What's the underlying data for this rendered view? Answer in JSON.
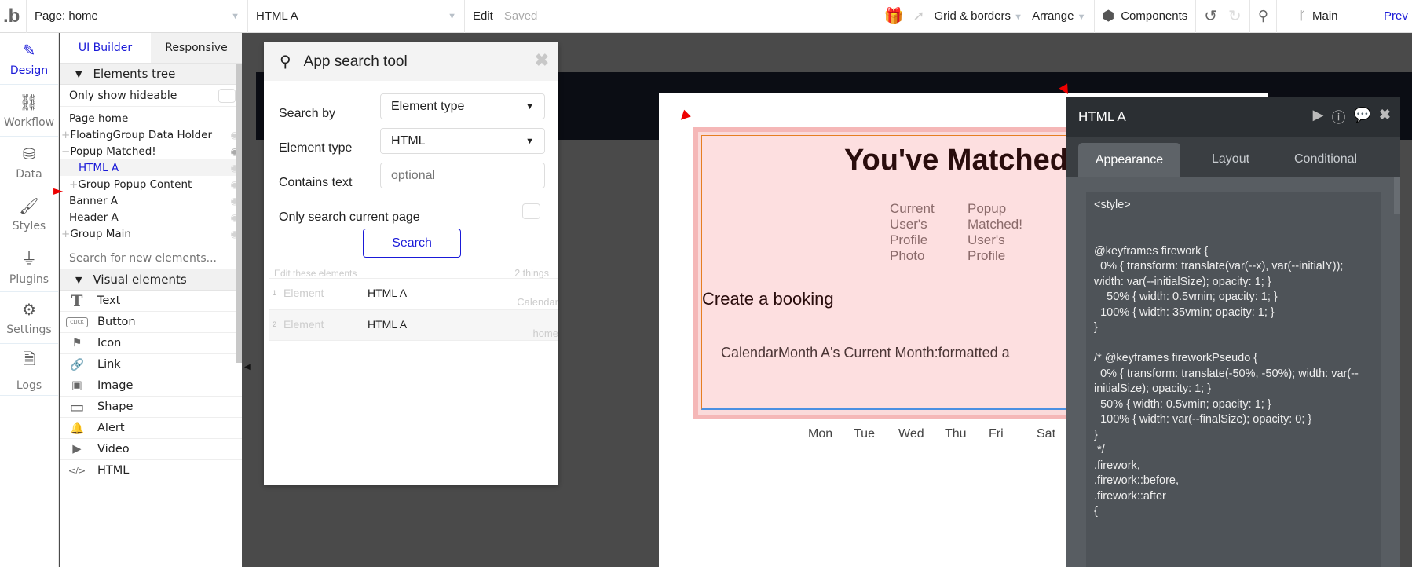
{
  "topbar": {
    "logo": ".b",
    "page_select": "Page: home",
    "element_select": "HTML A",
    "edit": "Edit",
    "saved": "Saved",
    "grid": "Grid & borders",
    "arrange": "Arrange",
    "components": "Components",
    "branch": "Main",
    "preview": "Prev"
  },
  "rail": [
    {
      "label": "Design",
      "icon": "design-icon"
    },
    {
      "label": "Workflow",
      "icon": "workflow-icon"
    },
    {
      "label": "Data",
      "icon": "database-icon"
    },
    {
      "label": "Styles",
      "icon": "brush-icon"
    },
    {
      "label": "Plugins",
      "icon": "plug-icon"
    },
    {
      "label": "Settings",
      "icon": "gear-icon"
    },
    {
      "label": "Logs",
      "icon": "document-icon"
    }
  ],
  "panel": {
    "tabs": [
      "UI Builder",
      "Responsive"
    ],
    "elements_tree": "Elements tree",
    "only_hideable": "Only show hideable",
    "tree": [
      {
        "label": "Page home",
        "prefix": ""
      },
      {
        "label": "FloatingGroup Data Holder",
        "prefix": "+"
      },
      {
        "label": "Popup Matched!",
        "prefix": "−"
      },
      {
        "label": "HTML A",
        "prefix": ""
      },
      {
        "label": "Group Popup Content",
        "prefix": "+"
      },
      {
        "label": "Banner A",
        "prefix": ""
      },
      {
        "label": "Header A",
        "prefix": ""
      },
      {
        "label": "Group Main",
        "prefix": "+"
      }
    ],
    "search_placeholder": "Search for new elements...",
    "visual_elements": "Visual elements",
    "visual": [
      {
        "label": "Text",
        "icon": "T"
      },
      {
        "label": "Button",
        "icon": "CLICK"
      },
      {
        "label": "Icon",
        "icon": "⚑"
      },
      {
        "label": "Link",
        "icon": "🔗"
      },
      {
        "label": "Image",
        "icon": "▣"
      },
      {
        "label": "Shape",
        "icon": "▭"
      },
      {
        "label": "Alert",
        "icon": "🔔"
      },
      {
        "label": "Video",
        "icon": "▶"
      },
      {
        "label": "HTML",
        "icon": "</>"
      }
    ]
  },
  "search_tool": {
    "title": "App search tool",
    "search_by_label": "Search by",
    "search_by_value": "Element type",
    "element_type_label": "Element type",
    "element_type_value": "HTML",
    "contains_label": "Contains text",
    "contains_placeholder": "optional",
    "only_current": "Only search current page",
    "search_button": "Search",
    "edit_these": "Edit these elements",
    "count": "2 things",
    "results": [
      {
        "n": "1",
        "type": "Element",
        "name": "HTML A",
        "page": "Calendar"
      },
      {
        "n": "2",
        "type": "Element",
        "name": "HTML A",
        "page": "home"
      }
    ]
  },
  "canvas": {
    "title": "You've Matched",
    "photo1": "Current User's Profile Photo",
    "photo2": "Popup Matched! User's Profile",
    "booking": "Create a booking",
    "calendar_text": "CalendarMonth A's Current Month:formatted a",
    "days": [
      "Mon",
      "Tue",
      "Wed",
      "Thu",
      "Fri",
      "Sat"
    ]
  },
  "editor": {
    "title": "HTML A",
    "tabs": [
      "Appearance",
      "Layout",
      "Conditional"
    ],
    "code": "<style>\n\n\n@keyframes firework {\n  0% { transform: translate(var(--x), var(--initialY)); width: var(--initialSize); opacity: 1; }\n    50% { width: 0.5vmin; opacity: 1; }\n  100% { width: 35vmin; opacity: 1; }\n}\n\n/* @keyframes fireworkPseudo {\n  0% { transform: translate(-50%, -50%); width: var(--initialSize); opacity: 1; }\n  50% { width: 0.5vmin; opacity: 1; }\n  100% { width: var(--finalSize); opacity: 0; }\n}\n */\n.firework,\n.firework::before,\n.firework::after\n{"
  },
  "colors": {
    "accent": "#1a1ad8",
    "canvas_bg": "#4a4a4a",
    "editor_bg": "#585d62",
    "pink": "#fddfe0"
  }
}
